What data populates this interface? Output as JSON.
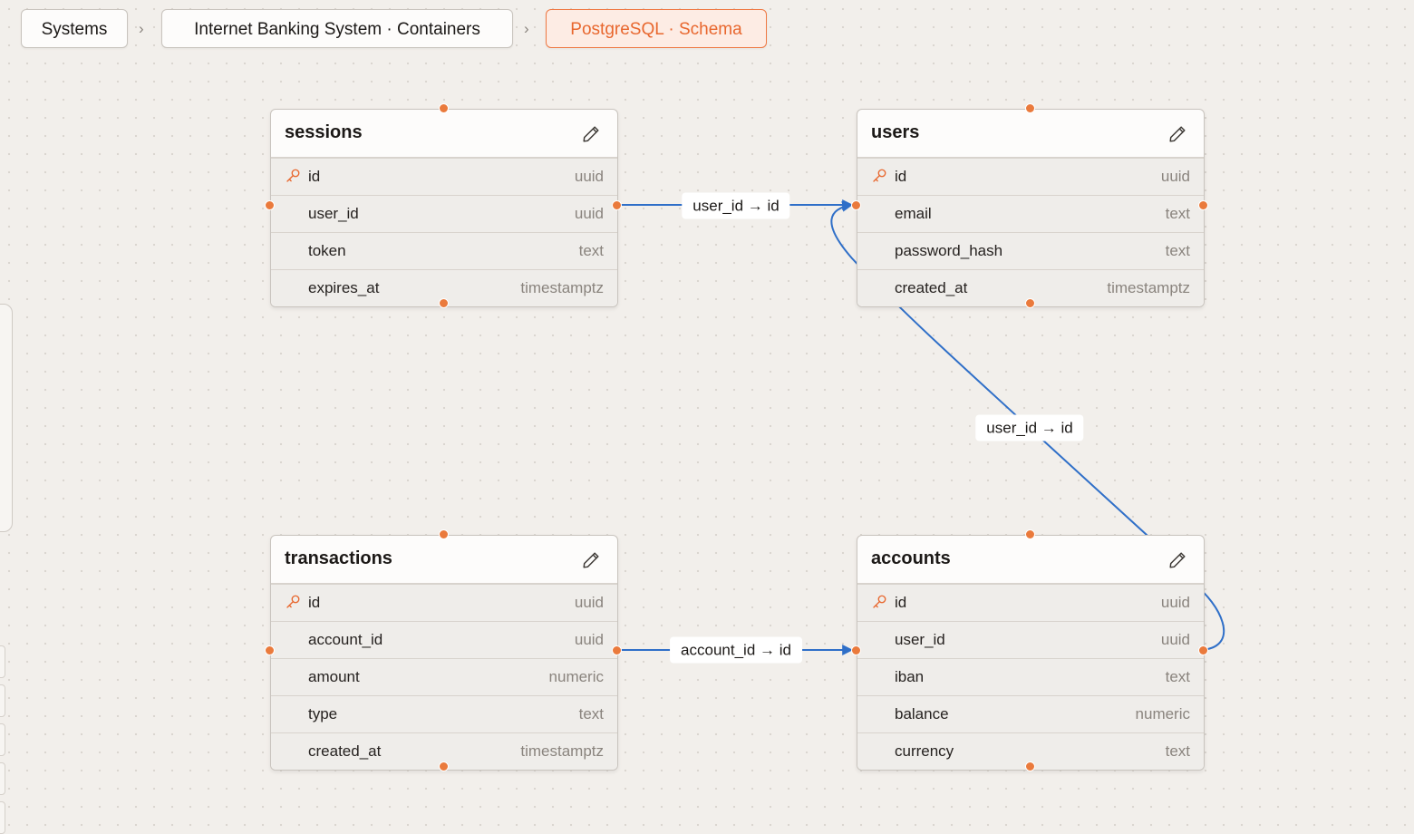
{
  "breadcrumbs": [
    {
      "label": "Systems"
    },
    {
      "label": "Internet Banking System · Containers"
    },
    {
      "label": "PostgreSQL · Schema"
    }
  ],
  "breadcrumb_separator": ">",
  "accent_color": "#e8672e",
  "edge_color": "#2f6fc8",
  "tables": {
    "sessions": {
      "name": "sessions",
      "columns": [
        {
          "name": "id",
          "type": "uuid",
          "pk": true
        },
        {
          "name": "user_id",
          "type": "uuid"
        },
        {
          "name": "token",
          "type": "text"
        },
        {
          "name": "expires_at",
          "type": "timestamptz"
        }
      ]
    },
    "users": {
      "name": "users",
      "columns": [
        {
          "name": "id",
          "type": "uuid",
          "pk": true
        },
        {
          "name": "email",
          "type": "text"
        },
        {
          "name": "password_hash",
          "type": "text"
        },
        {
          "name": "created_at",
          "type": "timestamptz"
        }
      ]
    },
    "transactions": {
      "name": "transactions",
      "columns": [
        {
          "name": "id",
          "type": "uuid",
          "pk": true
        },
        {
          "name": "account_id",
          "type": "uuid"
        },
        {
          "name": "amount",
          "type": "numeric"
        },
        {
          "name": "type",
          "type": "text"
        },
        {
          "name": "created_at",
          "type": "timestamptz"
        }
      ]
    },
    "accounts": {
      "name": "accounts",
      "columns": [
        {
          "name": "id",
          "type": "uuid",
          "pk": true
        },
        {
          "name": "user_id",
          "type": "uuid"
        },
        {
          "name": "iban",
          "type": "text"
        },
        {
          "name": "balance",
          "type": "numeric"
        },
        {
          "name": "currency",
          "type": "text"
        }
      ]
    }
  },
  "relations": [
    {
      "label": "user_id → id",
      "from": "sessions.user_id",
      "to": "users.id"
    },
    {
      "label": "user_id → id",
      "from": "accounts.user_id",
      "to": "users.id"
    },
    {
      "label": "account_id → id",
      "from": "transactions.account_id",
      "to": "accounts.id"
    }
  ],
  "icons": {
    "primary_key": "key-icon",
    "edit": "pencil-icon",
    "separator": "chevron-right-icon"
  }
}
